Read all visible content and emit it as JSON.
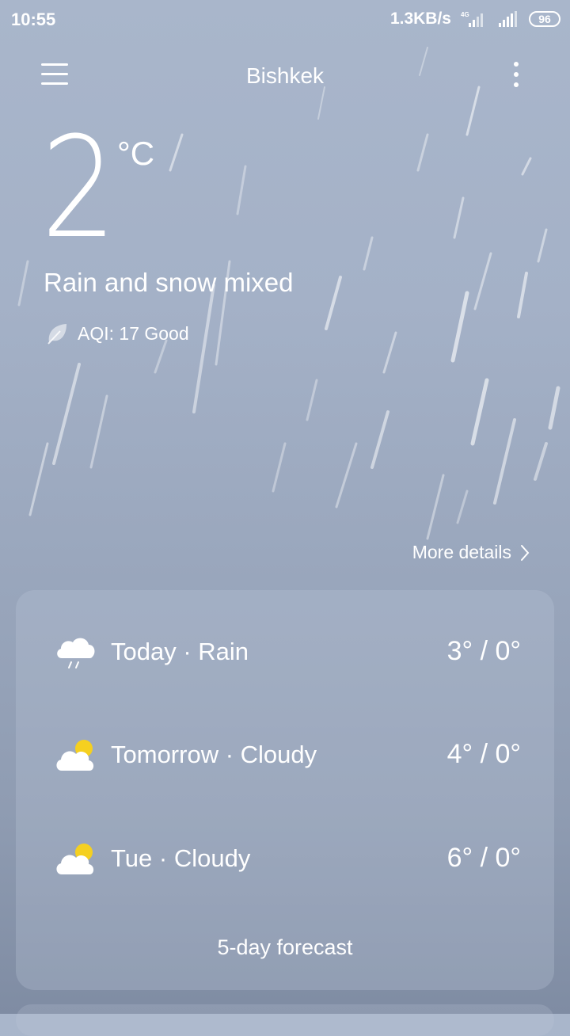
{
  "status_bar": {
    "time": "10:55",
    "net_speed": "1.3KB/s",
    "network_type": "4G",
    "battery": "96"
  },
  "header": {
    "city": "Bishkek"
  },
  "current": {
    "temperature": "2",
    "unit": "°C",
    "condition": "Rain and snow mixed",
    "aqi": "AQI: 17 Good"
  },
  "more_details_label": "More details",
  "forecast": {
    "rows": [
      {
        "label": "Today · Rain",
        "temps": "3° / 0°",
        "icon": "rain-cloud-icon"
      },
      {
        "label": "Tomorrow · Cloudy",
        "temps": "4° / 0°",
        "icon": "partly-cloudy-icon"
      },
      {
        "label": "Tue · Cloudy",
        "temps": "6° / 0°",
        "icon": "partly-cloudy-icon"
      }
    ],
    "button_label": "5-day forecast"
  },
  "colors": {
    "text": "#ffffff",
    "sun": "#f5d020",
    "background_top": "#a9b6cb",
    "background_bottom": "#7f8ca3"
  }
}
